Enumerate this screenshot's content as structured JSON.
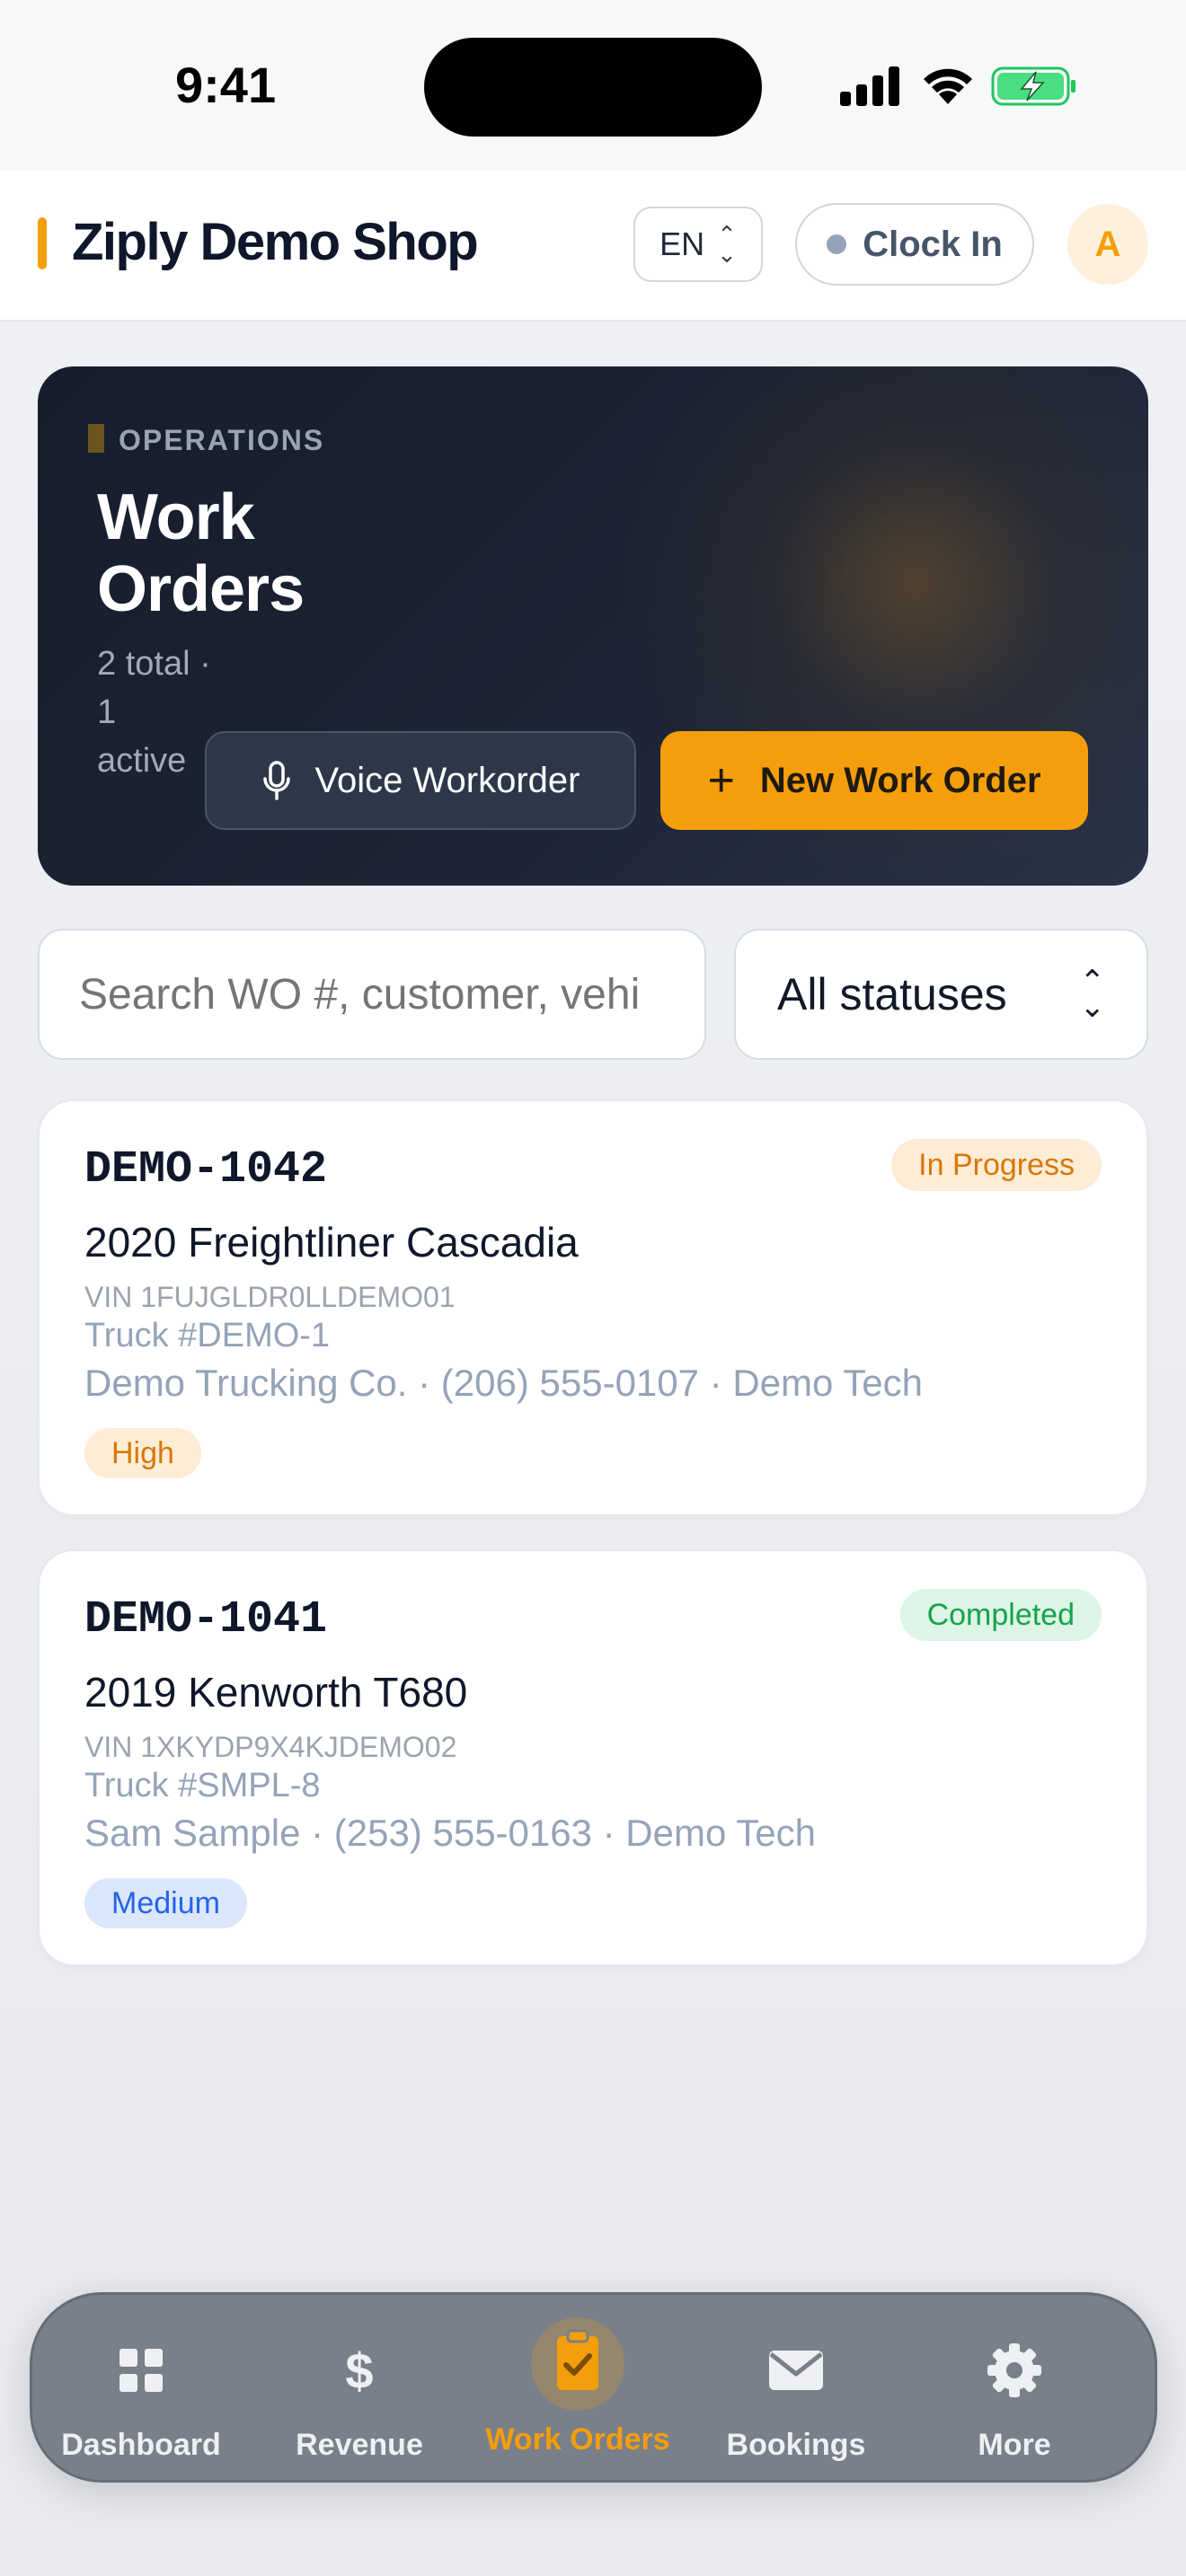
{
  "status_bar": {
    "time": "9:41"
  },
  "header": {
    "shop_name": "Ziply Demo Shop",
    "language": "EN",
    "clock_in_label": "Clock In",
    "avatar_initial": "A"
  },
  "hero": {
    "eyebrow": "OPERATIONS",
    "title": "Work Orders",
    "subtitle": "2 total · 1 active",
    "voice_button": "Voice Workorder",
    "new_button": "New Work Order"
  },
  "filters": {
    "search_placeholder": "Search WO #, customer, vehi",
    "status_value": "All statuses"
  },
  "work_orders": [
    {
      "number": "DEMO-1042",
      "status": "In Progress",
      "vehicle": "2020 Freightliner Cascadia",
      "vin": "VIN 1FUJGLDR0LLDEMO01",
      "truck": "Truck #DEMO-1",
      "customer_line": "Demo Trucking Co. · (206) 555-0107 · Demo Tech",
      "priority": "High"
    },
    {
      "number": "DEMO-1041",
      "status": "Completed",
      "vehicle": "2019 Kenworth T680",
      "vin": "VIN 1XKYDP9X4KJDEMO02",
      "truck": "Truck #SMPL-8",
      "customer_line": "Sam Sample · (253) 555-0163 · Demo Tech",
      "priority": "Medium"
    }
  ],
  "nav": {
    "items": [
      {
        "label": "Dashboard",
        "icon": "grid-icon"
      },
      {
        "label": "Revenue",
        "icon": "dollar-icon"
      },
      {
        "label": "Work Orders",
        "icon": "clipboard-check-icon",
        "active": true
      },
      {
        "label": "Bookings",
        "icon": "envelope-icon"
      },
      {
        "label": "More",
        "icon": "gear-icon"
      }
    ]
  },
  "colors": {
    "accent": "#f59e0b",
    "hero_bg": "#1b2232",
    "in_progress_bg": "#fdecd6",
    "in_progress_text": "#d97706",
    "completed_bg": "#dcf5e6",
    "completed_text": "#16a34a",
    "medium_bg": "#dbe7fd",
    "medium_text": "#2563eb"
  }
}
